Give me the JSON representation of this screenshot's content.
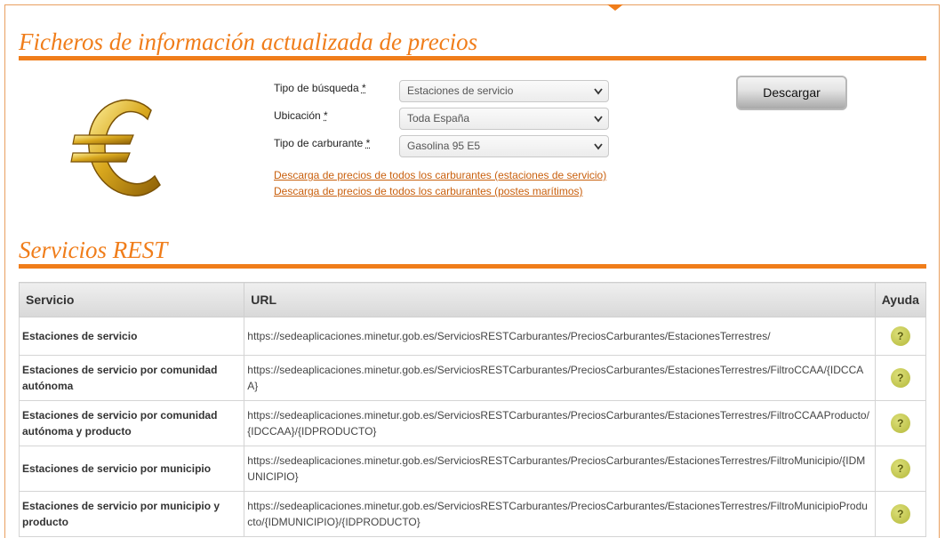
{
  "header": {
    "title": "Ficheros de información actualizada de precios"
  },
  "form": {
    "busqueda_label": "Tipo de búsqueda",
    "ubicacion_label": "Ubicación",
    "carburante_label": "Tipo de carburante",
    "required_mark": "*",
    "busqueda_value": "Estaciones de servicio",
    "ubicacion_value": "Toda España",
    "carburante_value": "Gasolina 95 E5",
    "download_button": "Descargar",
    "link_estaciones": "Descarga de precios de todos los carburantes (estaciones de servicio)",
    "link_postes": "Descarga de precios de todos los carburantes (postes marítimos)"
  },
  "rest": {
    "title": "Servicios REST",
    "columns": [
      "Servicio",
      "URL",
      "Ayuda"
    ],
    "rows": [
      {
        "service": "Estaciones de servicio",
        "url": "https://sedeaplicaciones.minetur.gob.es/ServiciosRESTCarburantes/PreciosCarburantes/EstacionesTerrestres/",
        "help": "?"
      },
      {
        "service": "Estaciones de servicio por comunidad autónoma",
        "url": "https://sedeaplicaciones.minetur.gob.es/ServiciosRESTCarburantes/PreciosCarburantes/EstacionesTerrestres/FiltroCCAA/{IDCCAA}",
        "help": "?"
      },
      {
        "service": "Estaciones de servicio por comunidad autónoma y producto",
        "url": "https://sedeaplicaciones.minetur.gob.es/ServiciosRESTCarburantes/PreciosCarburantes/EstacionesTerrestres/FiltroCCAAProducto/{IDCCAA}/{IDPRODUCTO}",
        "help": "?"
      },
      {
        "service": "Estaciones de servicio por municipio",
        "url": "https://sedeaplicaciones.minetur.gob.es/ServiciosRESTCarburantes/PreciosCarburantes/EstacionesTerrestres/FiltroMunicipio/{IDMUNICIPIO}",
        "help": "?"
      },
      {
        "service": "Estaciones de servicio por municipio y producto",
        "url": "https://sedeaplicaciones.minetur.gob.es/ServiciosRESTCarburantes/PreciosCarburantes/EstacionesTerrestres/FiltroMunicipioProducto/{IDMUNICIPIO}/{IDPRODUCTO}",
        "help": "?"
      }
    ]
  },
  "icons": {
    "logo": "euro-icon",
    "help": "help-icon",
    "dropdown": "chevron-down-icon"
  },
  "colors": {
    "accent": "#f07d1a",
    "link": "#c9600e"
  }
}
